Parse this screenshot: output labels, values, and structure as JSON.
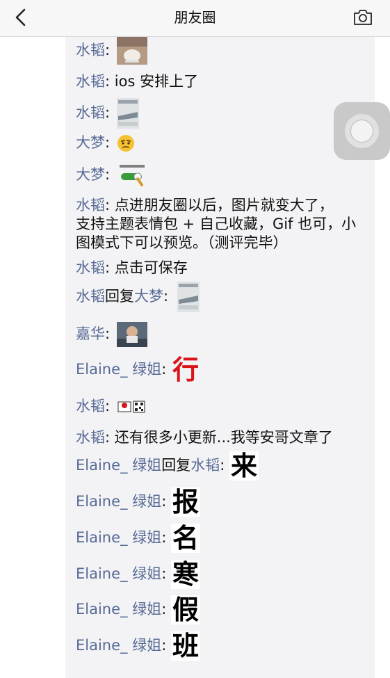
{
  "nav": {
    "title": "朋友圈",
    "back_icon": "back-chevron-icon",
    "camera_icon": "camera-icon"
  },
  "comments": [
    {
      "name": "水韬",
      "text": "",
      "sticker": "cat-paw-photo"
    },
    {
      "name": "水韬",
      "text": "ios 安排上了"
    },
    {
      "name": "水韬",
      "text": "",
      "sticker": "train-photo-sticker"
    },
    {
      "name": "大梦",
      "text": "",
      "sticker": "thinking-face-emoji"
    },
    {
      "name": "大梦",
      "text": "",
      "sticker": "green-toggle-sticker"
    },
    {
      "name": "水韬",
      "text_lines": [
        "点进朋友圈以后，图片就变大了，",
        "支持主题表情包 + 自己收藏，Gif 也可，小",
        "图模式下可以预览。（测评完毕）"
      ]
    },
    {
      "name": "水韬",
      "text": "点击可保存"
    },
    {
      "name": "水韬",
      "reply_word": "回复",
      "reply_to": "大梦",
      "text": "",
      "sticker": "train-photo-sticker"
    },
    {
      "name": "嘉华",
      "text": "",
      "sticker": "man-photo-sticker"
    },
    {
      "name": "Elaine_ 绿姐",
      "text": "",
      "big_char": "行"
    },
    {
      "name": "水韬",
      "text": "",
      "sticker": "qr-code-sticker"
    },
    {
      "name": "水韬",
      "text": "还有很多小更新...我等安哥文章了"
    },
    {
      "name": "Elaine_ 绿姐",
      "reply_word": "回复",
      "reply_to": "水韬",
      "big_char": "来"
    },
    {
      "name": "Elaine_ 绿姐",
      "big_char": "报"
    },
    {
      "name": "Elaine_ 绿姐",
      "big_char": "名"
    },
    {
      "name": "Elaine_ 绿姐",
      "big_char": "寒"
    },
    {
      "name": "Elaine_ 绿姐",
      "big_char": "假"
    },
    {
      "name": "Elaine_ 绿姐",
      "big_char": "班"
    }
  ],
  "colors": {
    "name": "#586b95",
    "comments_bg": "#f3f3f5",
    "nav_bg": "#f7f7f7",
    "big_char_red": "#d9141b"
  },
  "assistive_touch_icon": "assistive-touch-icon"
}
